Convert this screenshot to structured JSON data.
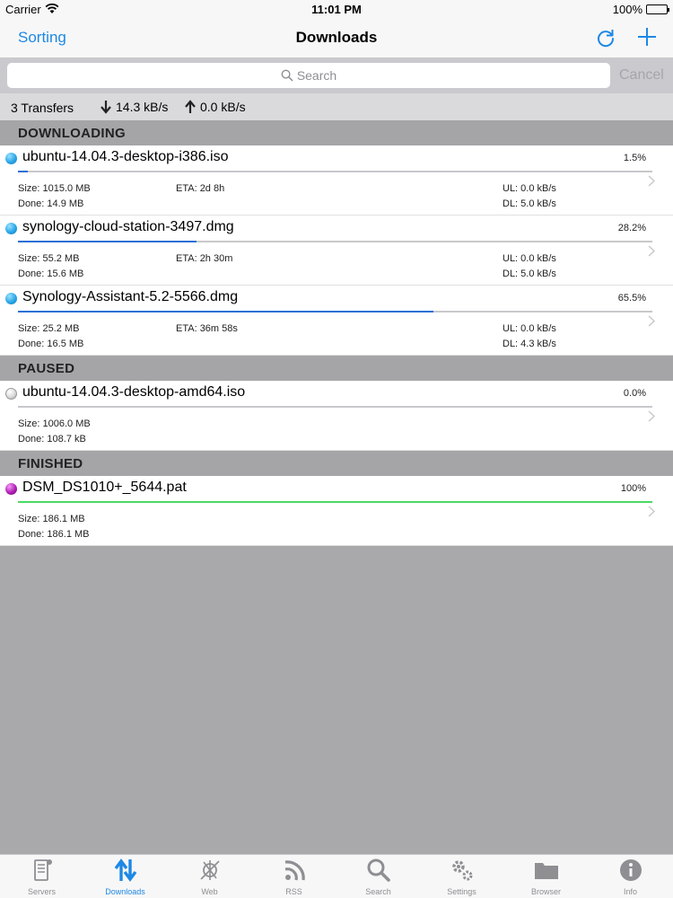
{
  "status_bar": {
    "carrier": "Carrier",
    "time": "11:01 PM",
    "battery": "100%"
  },
  "nav": {
    "sorting_label": "Sorting",
    "title": "Downloads",
    "refresh_icon": "refresh-icon",
    "add_icon": "plus-icon"
  },
  "search": {
    "placeholder": "Search",
    "cancel_label": "Cancel"
  },
  "summary": {
    "transfers": "3 Transfers",
    "download_speed": "14.3 kB/s",
    "upload_speed": "0.0 kB/s"
  },
  "sections": {
    "downloading": "DOWNLOADING",
    "paused": "PAUSED",
    "finished": "FINISHED"
  },
  "colors": {
    "accent": "#1e88e5",
    "downloading_dot": "#2aa6e8",
    "paused_dot": "#d2d2d2",
    "finished_dot": "#b01fb5",
    "progress_active": "#2b6fd6",
    "progress_done": "#4cd964"
  },
  "downloads": [
    {
      "name": "ubuntu-14.04.3-desktop-i386.iso",
      "percent": "1.5%",
      "progress": 1.5,
      "size": "Size: 1015.0 MB",
      "done": "Done: 14.9 MB",
      "eta": "ETA: 2d 8h",
      "ul": "UL: 0.0 kB/s",
      "dl": "DL: 5.0 kB/s"
    },
    {
      "name": "synology-cloud-station-3497.dmg",
      "percent": "28.2%",
      "progress": 28.2,
      "size": "Size: 55.2 MB",
      "done": "Done: 15.6 MB",
      "eta": "ETA: 2h 30m",
      "ul": "UL: 0.0 kB/s",
      "dl": "DL: 5.0 kB/s"
    },
    {
      "name": "Synology-Assistant-5.2-5566.dmg",
      "percent": "65.5%",
      "progress": 65.5,
      "size": "Size: 25.2 MB",
      "done": "Done: 16.5 MB",
      "eta": "ETA: 36m 58s",
      "ul": "UL: 0.0 kB/s",
      "dl": "DL: 4.3 kB/s"
    }
  ],
  "paused": [
    {
      "name": "ubuntu-14.04.3-desktop-amd64.iso",
      "percent": "0.0%",
      "progress": 0,
      "size": "Size: 1006.0 MB",
      "done": "Done: 108.7 kB"
    }
  ],
  "finished": [
    {
      "name": "DSM_DS1010+_5644.pat",
      "percent": "100%",
      "progress": 100,
      "size": "Size: 186.1 MB",
      "done": "Done: 186.1 MB"
    }
  ],
  "tabs": [
    {
      "label": "Servers",
      "icon": "servers-icon",
      "active": false
    },
    {
      "label": "Downloads",
      "icon": "downloads-icon",
      "active": true
    },
    {
      "label": "Web",
      "icon": "web-icon",
      "active": false
    },
    {
      "label": "RSS",
      "icon": "rss-icon",
      "active": false
    },
    {
      "label": "Search",
      "icon": "search-icon",
      "active": false
    },
    {
      "label": "Settings",
      "icon": "settings-icon",
      "active": false
    },
    {
      "label": "Browser",
      "icon": "folder-icon",
      "active": false
    },
    {
      "label": "Info",
      "icon": "info-icon",
      "active": false
    }
  ]
}
